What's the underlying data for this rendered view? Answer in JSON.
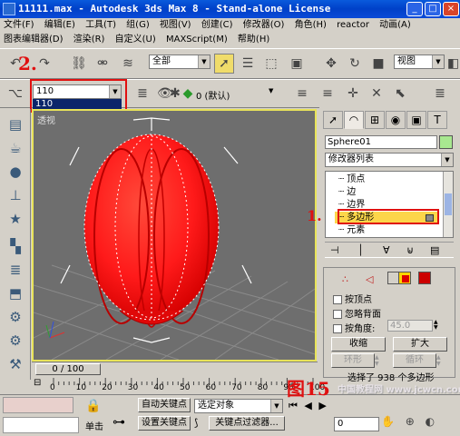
{
  "window": {
    "title": "11111.max - Autodesk 3ds Max 8 - Stand-alone License",
    "minimize": "_",
    "maximize": "□",
    "close": "×"
  },
  "menu1": [
    "文件(F)",
    "编辑(E)",
    "工具(T)",
    "组(G)",
    "视图(V)",
    "创建(C)",
    "修改器(O)",
    "角色(H)",
    "reactor",
    "动画(A)"
  ],
  "menu2": [
    "图表编辑器(D)",
    "渲染(R)",
    "自定义(U)",
    "MAXScript(M)",
    "帮助(H)"
  ],
  "toolbar": {
    "selection_filter": "全部",
    "ref_coord": "视图"
  },
  "selection_set": {
    "value": "110",
    "dropdown_item": "110"
  },
  "layer": {
    "value": "0 (默认)"
  },
  "viewport": {
    "label": "透视"
  },
  "panel": {
    "object_name": "Sphere01",
    "modifier_list": "修改器列表",
    "stack_items": [
      "顶点",
      "边",
      "边界",
      "多边形",
      "元素"
    ],
    "rollout": {
      "by_vertex": "按顶点",
      "ignore_backfacing": "忽略背面",
      "by_angle": "按角度:",
      "angle_value": "45.0",
      "shrink": "收缩",
      "grow": "扩大",
      "ring": "环形",
      "loop": "循环",
      "status": "选择了 938 个多边形"
    }
  },
  "timeline": {
    "frame": "0 / 100",
    "ticks": [
      "0",
      "10",
      "20",
      "30",
      "40",
      "50",
      "60",
      "70",
      "80",
      "90",
      "100"
    ]
  },
  "statusbar": {
    "auto_key": "自动关键点",
    "set_key": "设置关键点",
    "selected_object": "选定对象",
    "key_filters": "关键点过滤器...",
    "single_click": "单击",
    "frame_value": "0"
  },
  "annotations": {
    "label1": "1.",
    "label2": "2.",
    "caption": "图15"
  },
  "watermark": "中国教程网 www.jcwcn.com",
  "colors": {
    "title_bar": "#0a5adc",
    "sphere": "#ff1a1a",
    "viewport_border": "#e8e35a",
    "annotation": "#e01010",
    "object_color_swatch": "#a8e890"
  }
}
